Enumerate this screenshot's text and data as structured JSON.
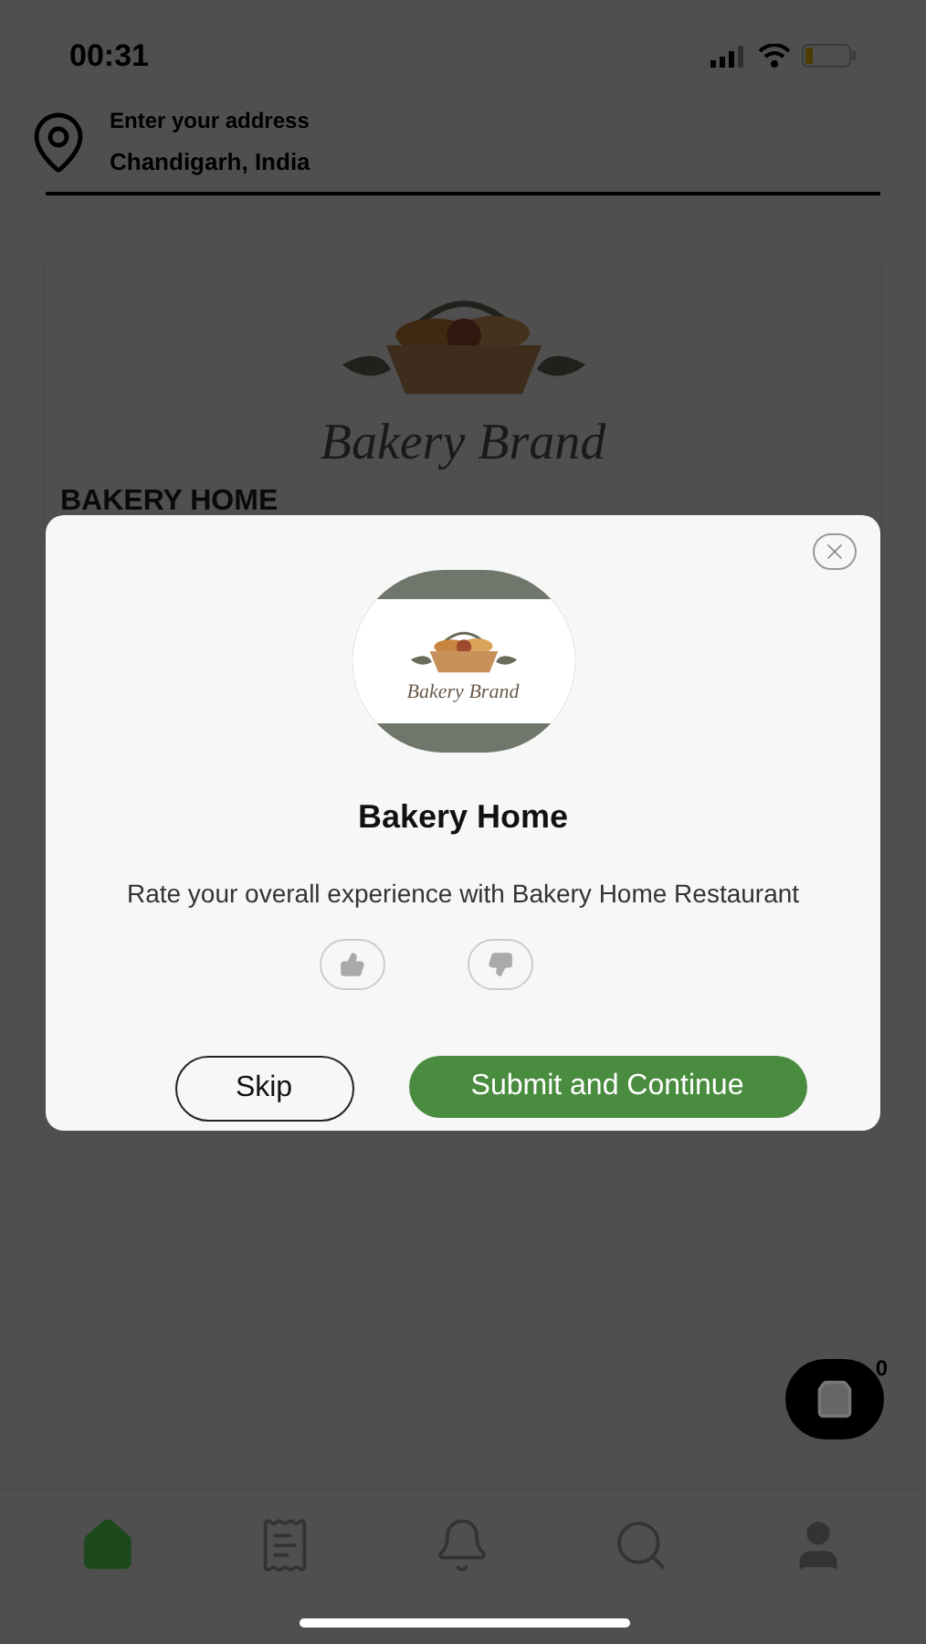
{
  "status_bar": {
    "time": "00:31"
  },
  "address": {
    "label": "Enter your address",
    "value": "Chandigarh, India"
  },
  "restaurant_card": {
    "logo_text": "Bakery Brand",
    "name": "BAKERY HOME"
  },
  "dialog": {
    "logo_text": "Bakery Brand",
    "title": "Bakery Home",
    "prompt": "Rate your overall experience with Bakery Home Restaurant",
    "ratings": [
      {
        "kind": "up",
        "selected": false
      },
      {
        "kind": "down",
        "selected": false
      }
    ],
    "buttons": [
      {
        "kind": "secondary",
        "label": "Skip"
      },
      {
        "kind": "primary",
        "label": "Submit and Continue"
      }
    ]
  },
  "cart": {
    "count": "0"
  },
  "nav": [
    {
      "kind": "home",
      "selected": true
    },
    {
      "kind": "orders",
      "selected": false
    },
    {
      "kind": "notifications",
      "selected": false
    },
    {
      "kind": "search",
      "selected": false
    },
    {
      "kind": "profile",
      "selected": false
    }
  ]
}
